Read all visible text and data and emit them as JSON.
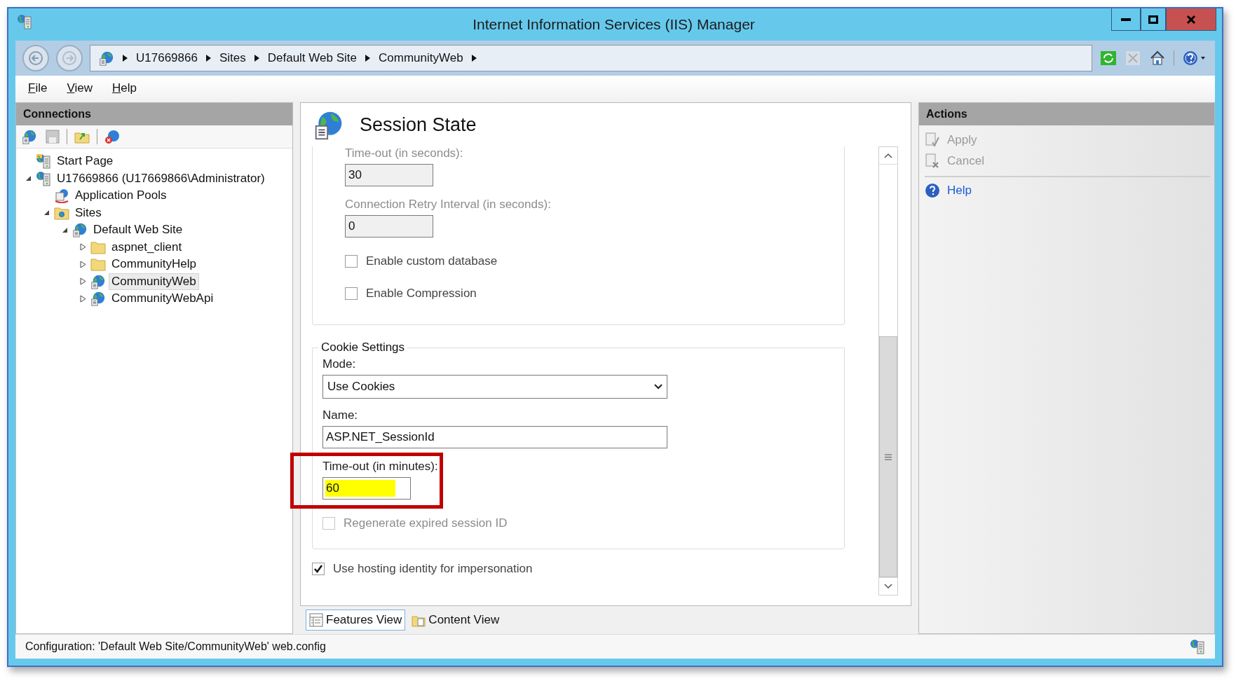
{
  "window": {
    "title": "Internet Information Services (IIS) Manager"
  },
  "address_bar": {
    "breadcrumbs": [
      "U17669866",
      "Sites",
      "Default Web Site",
      "CommunityWeb"
    ]
  },
  "menu": [
    "File",
    "View",
    "Help"
  ],
  "connections": {
    "title": "Connections",
    "tree": [
      {
        "label": "Start Page",
        "kind": "start",
        "selected": false
      },
      {
        "label": "U17669866 (U17669866\\Administrator)",
        "kind": "server",
        "expanded": true,
        "selected": false,
        "children": [
          {
            "label": "Application Pools",
            "kind": "pools",
            "selected": false
          },
          {
            "label": "Sites",
            "kind": "sites",
            "expanded": true,
            "selected": false,
            "children": [
              {
                "label": "Default Web Site",
                "kind": "site",
                "expanded": true,
                "selected": false,
                "children": [
                  {
                    "label": "aspnet_client",
                    "kind": "folder",
                    "expanded": false,
                    "selected": false
                  },
                  {
                    "label": "CommunityHelp",
                    "kind": "folder",
                    "expanded": false,
                    "selected": false
                  },
                  {
                    "label": "CommunityWeb",
                    "kind": "app",
                    "expanded": false,
                    "selected": true
                  },
                  {
                    "label": "CommunityWebApi",
                    "kind": "app",
                    "expanded": false,
                    "selected": false
                  }
                ]
              }
            ]
          }
        ]
      }
    ]
  },
  "feature": {
    "title": "Session State",
    "groups": [
      {
        "fields": [
          {
            "kind": "text",
            "label": "Time-out (in seconds):",
            "value": "30",
            "disabled": true
          },
          {
            "kind": "text",
            "label": "Connection Retry Interval (in seconds):",
            "value": "0",
            "disabled": true
          },
          {
            "kind": "checkbox",
            "label": "Enable custom database",
            "checked": false,
            "disabled": false
          },
          {
            "kind": "checkbox",
            "label": "Enable Compression",
            "checked": false,
            "disabled": false
          }
        ]
      },
      {
        "legend": "Cookie Settings",
        "fields": [
          {
            "kind": "select",
            "label": "Mode:",
            "value": "Use Cookies"
          },
          {
            "kind": "text",
            "label": "Name:",
            "value": "ASP.NET_SessionId",
            "disabled": false,
            "wide": true
          },
          {
            "kind": "text",
            "label": "Time-out (in minutes):",
            "value": "60",
            "disabled": false,
            "highlighted": true,
            "annotated": true
          },
          {
            "kind": "checkbox",
            "label": "Regenerate expired session ID",
            "checked": false,
            "disabled": true
          }
        ]
      }
    ],
    "options": [
      {
        "kind": "checkbox",
        "label": "Use hosting identity for impersonation",
        "checked": true,
        "disabled": false
      }
    ]
  },
  "view_tabs": [
    {
      "label": "Features View",
      "selected": true
    },
    {
      "label": "Content View",
      "selected": false
    }
  ],
  "actions": {
    "title": "Actions",
    "items": [
      {
        "label": "Apply",
        "kind": "apply",
        "disabled": true
      },
      {
        "label": "Cancel",
        "kind": "cancel",
        "disabled": true
      },
      {
        "label": "Help",
        "kind": "help",
        "disabled": false
      }
    ]
  },
  "status_bar": {
    "text": "Configuration: 'Default Web Site/CommunityWeb' web.config"
  }
}
